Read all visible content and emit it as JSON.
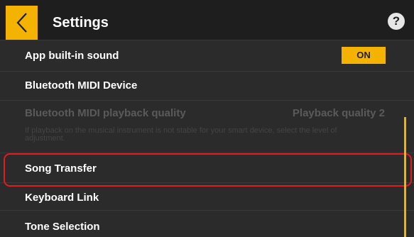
{
  "header": {
    "back_icon": "chevron-left-icon",
    "title": "Settings",
    "help_icon": "question-mark-icon",
    "help_glyph": "?"
  },
  "settings": {
    "app_sound": {
      "label": "App built-in sound",
      "toggle": "ON"
    },
    "bluetooth_midi_device": {
      "label": "Bluetooth MIDI Device"
    },
    "bluetooth_quality": {
      "label": "Bluetooth MIDI playback quality",
      "value": "Playback quality 2",
      "note": "If playback on the musical instrument is not stable for your smart device, select the level of adjustment."
    },
    "song_transfer": {
      "label": "Song Transfer"
    },
    "keyboard_link": {
      "label": "Keyboard Link"
    },
    "tone_selection": {
      "label": "Tone Selection"
    }
  },
  "colors": {
    "accent": "#f5b301",
    "highlight": "#e01b24",
    "background": "#2b2b2b",
    "header": "#1e1e1e"
  }
}
